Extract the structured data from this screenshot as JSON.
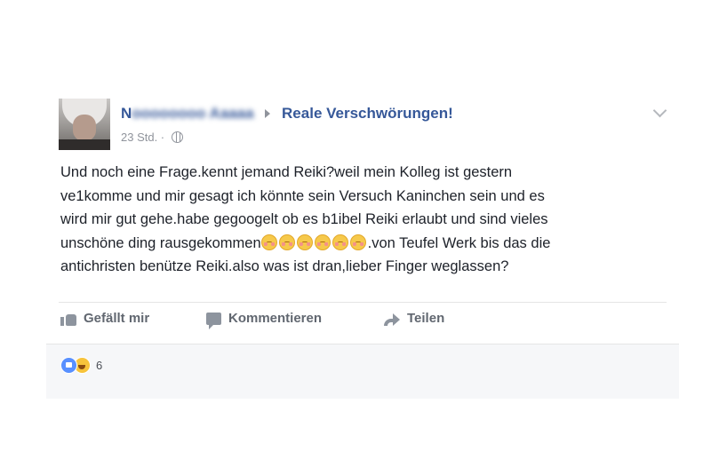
{
  "post": {
    "author_visible_start": "N",
    "author_blurred": "oooooooo A",
    "author_blurred_tail": "aaaa",
    "group_name": "Reale Verschwörungen!",
    "timestamp": "23 Std. ·",
    "privacy_icon": "globe-icon",
    "lines": [
      "Und noch eine Frage.kennt jemand Reiki?weil mein Kolleg ist gestern",
      "ve1komme und mir gesagt ich könnte sein Versuch Kaninchen sein und es",
      "wird mir gut gehe.habe gegoogelt ob es b1ibel Reiki erlaubt und sind vieles"
    ],
    "line4_prefix": "unschöne ding rausgekommen",
    "line4_suffix": ".von Teufel Werk bis das die",
    "line5": "antichristen benütze Reiki.also was ist dran,lieber Finger weglassen?",
    "emoji_name": "flushed-face-icon",
    "emoji_count": 6
  },
  "actions": {
    "like_label": "Gefällt mir",
    "comment_label": "Kommentieren",
    "share_label": "Teilen"
  },
  "reactions": {
    "count": "6",
    "types": [
      "like-icon",
      "haha-icon"
    ]
  },
  "colors": {
    "link": "#365899",
    "text": "#1d2129",
    "meta": "#90949c",
    "action": "#616770"
  }
}
